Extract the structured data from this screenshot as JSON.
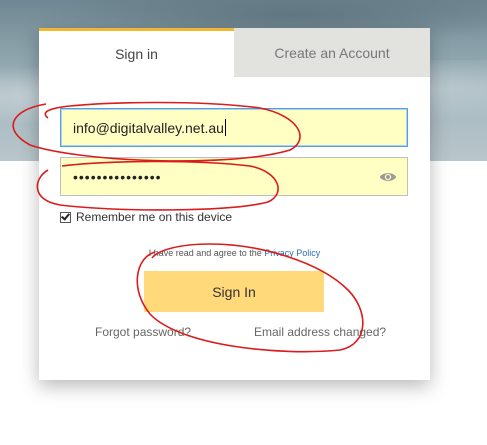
{
  "tabs": {
    "signin_label": "Sign in",
    "create_label": "Create an Account"
  },
  "form": {
    "email_value": "info@digitalvalley.net.au",
    "password_value": "•••••••••••••••",
    "remember_label": "Remember me on this device",
    "remember_checked": true,
    "agree_prefix": "I have read and agree to the",
    "privacy_link": "Privacy Policy",
    "signin_button": "Sign In"
  },
  "links": {
    "forgot": "Forgot password?",
    "email_changed": "Email address changed?"
  },
  "colors": {
    "tab_accent": "#f2b731",
    "input_bg": "#ffffc4",
    "button_bg": "#ffd97a",
    "annotation_red": "#d91c1c"
  },
  "icons": {
    "password_toggle": "eye-icon",
    "remember": "checkbox-checked"
  }
}
